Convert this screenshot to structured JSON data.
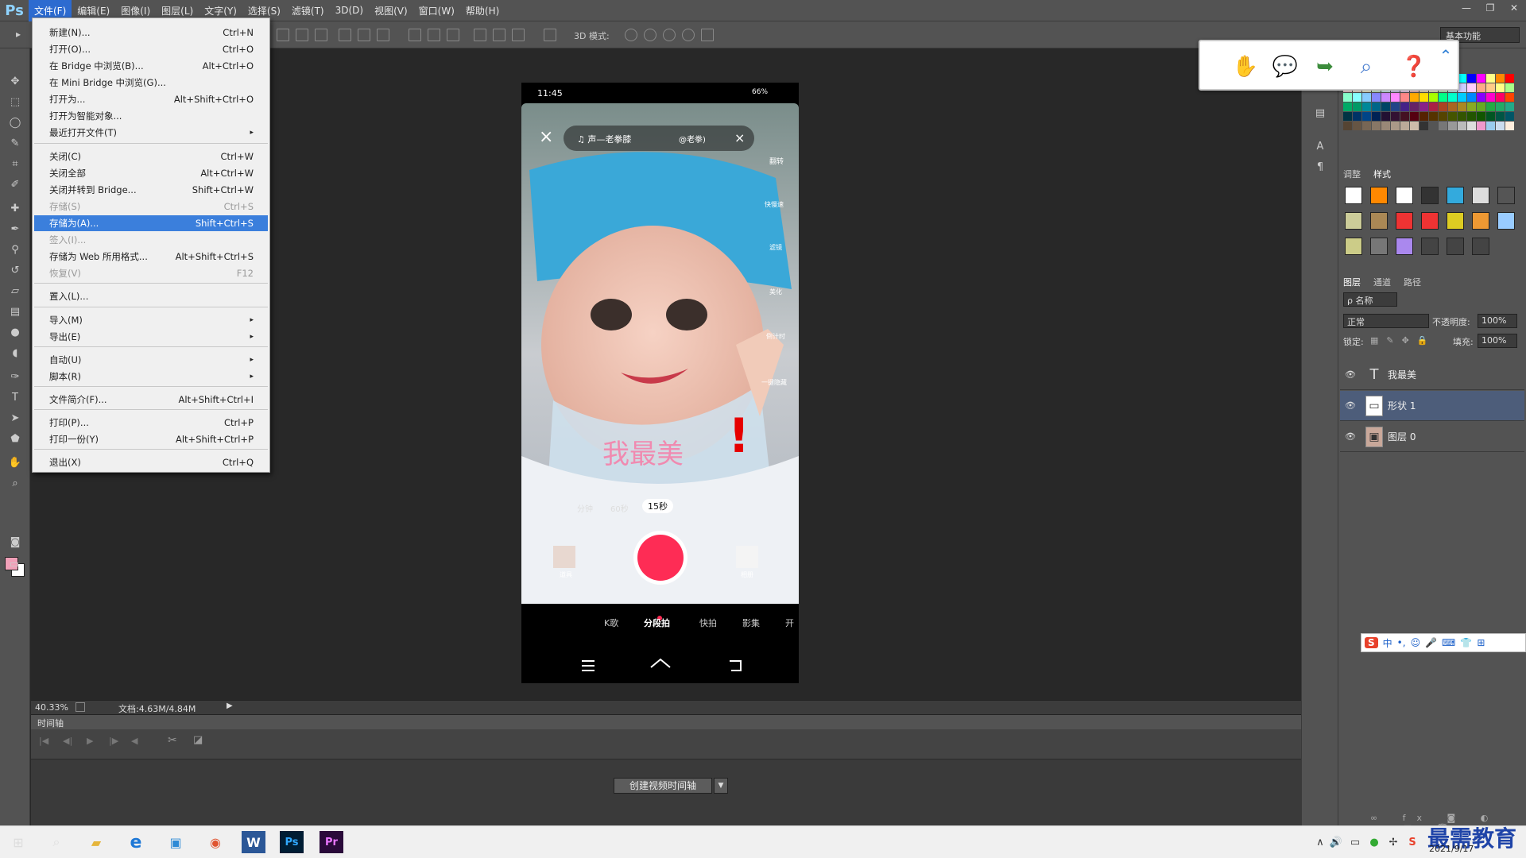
{
  "app": {
    "logo": "Ps"
  },
  "menubar": {
    "items": [
      "文件(F)",
      "编辑(E)",
      "图像(I)",
      "图层(L)",
      "文字(Y)",
      "选择(S)",
      "滤镜(T)",
      "3D(D)",
      "视图(V)",
      "窗口(W)",
      "帮助(H)"
    ]
  },
  "window_controls": [
    "—",
    "❐",
    "✕"
  ],
  "options": {
    "mode3d": "3D 模式:",
    "workspace": "基本功能"
  },
  "file_menu": {
    "items": [
      {
        "label": "新建(N)...",
        "shortcut": "Ctrl+N"
      },
      {
        "label": "打开(O)...",
        "shortcut": "Ctrl+O"
      },
      {
        "label": "在 Bridge 中浏览(B)...",
        "shortcut": "Alt+Ctrl+O"
      },
      {
        "label": "在 Mini Bridge 中浏览(G)...",
        "shortcut": ""
      },
      {
        "label": "打开为...",
        "shortcut": "Alt+Shift+Ctrl+O"
      },
      {
        "label": "打开为智能对象...",
        "shortcut": ""
      },
      {
        "label": "最近打开文件(T)",
        "shortcut": "▸"
      },
      {
        "label": "关闭(C)",
        "shortcut": "Ctrl+W"
      },
      {
        "label": "关闭全部",
        "shortcut": "Alt+Ctrl+W"
      },
      {
        "label": "关闭并转到 Bridge...",
        "shortcut": "Shift+Ctrl+W"
      },
      {
        "label": "存储(S)",
        "shortcut": "Ctrl+S"
      },
      {
        "label": "存储为(A)...",
        "shortcut": "Shift+Ctrl+S"
      },
      {
        "label": "签入(I)...",
        "shortcut": ""
      },
      {
        "label": "存储为 Web 所用格式...",
        "shortcut": "Alt+Shift+Ctrl+S"
      },
      {
        "label": "恢复(V)",
        "shortcut": "F12"
      },
      {
        "label": "置入(L)...",
        "shortcut": ""
      },
      {
        "label": "导入(M)",
        "shortcut": "▸"
      },
      {
        "label": "导出(E)",
        "shortcut": "▸"
      },
      {
        "label": "自动(U)",
        "shortcut": "▸"
      },
      {
        "label": "脚本(R)",
        "shortcut": "▸"
      },
      {
        "label": "文件简介(F)...",
        "shortcut": "Alt+Shift+Ctrl+I"
      },
      {
        "label": "打印(P)...",
        "shortcut": "Ctrl+P"
      },
      {
        "label": "打印一份(Y)",
        "shortcut": "Alt+Shift+Ctrl+P"
      },
      {
        "label": "退出(X)",
        "shortcut": "Ctrl+Q"
      }
    ]
  },
  "status": {
    "zoom": "40.33%",
    "doc": "文档:4.63M/4.84M"
  },
  "timeline": {
    "title": "时间轴",
    "create_button": "创建视频时间轴"
  },
  "panels": {
    "adjust_tab": "调整",
    "styles_tab": "样式",
    "layers_tab": "图层",
    "channels_tab": "通道",
    "paths_tab": "路径",
    "filter_kind": "ρ 名称",
    "blend_mode": "正常",
    "opacity_label": "不透明度:",
    "opacity_value": "100%",
    "lock_label": "锁定:",
    "fill_label": "填充:",
    "fill_value": "100%",
    "layers": [
      {
        "name": "我最美",
        "kind": "text",
        "thumb": "T"
      },
      {
        "name": "形状 1",
        "kind": "shape",
        "thumb": "▭"
      },
      {
        "name": "图层 0",
        "kind": "image",
        "thumb": "▣"
      }
    ]
  },
  "canvas": {
    "status_time": "11:45",
    "status_right": "66%",
    "music_label": "♫ 声—老拳膝",
    "music_right": "@老拳)",
    "side_labels": [
      "翻转",
      "快慢速",
      "滤镜",
      "美化",
      "倒计时",
      "一键隐藏"
    ],
    "overlay_text": "我最美",
    "exclaim": "!",
    "durations": [
      "分钟",
      "60秒",
      "15秒"
    ],
    "props_label": "道具",
    "album_label": "相册",
    "modes": [
      "K歌",
      "分段拍",
      "快拍",
      "影集",
      "开"
    ]
  },
  "ime": {
    "brand": "S",
    "items": [
      "中",
      "•,",
      "☺",
      "🎤",
      "⌨",
      "👕",
      "⊞"
    ]
  },
  "taskbar": {
    "date": "2021/9/17"
  },
  "watermark": "最需教育",
  "colors": {
    "accent": "#2d6bd0",
    "record": "#fe2c55",
    "overlay_pink": "#f08ab0",
    "exclaim": "#e60000"
  }
}
